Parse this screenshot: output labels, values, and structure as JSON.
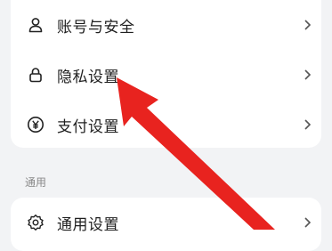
{
  "account_group": {
    "items": [
      {
        "label": "账号与安全",
        "icon": "user-icon"
      },
      {
        "label": "隐私设置",
        "icon": "lock-icon"
      },
      {
        "label": "支付设置",
        "icon": "yen-icon"
      }
    ]
  },
  "general_section": {
    "title": "通用",
    "items": [
      {
        "label": "通用设置",
        "icon": "gear-icon"
      }
    ]
  },
  "chevron": ">",
  "colors": {
    "arrow": "#e8231f",
    "background": "#f2f3f5",
    "card": "#ffffff"
  }
}
